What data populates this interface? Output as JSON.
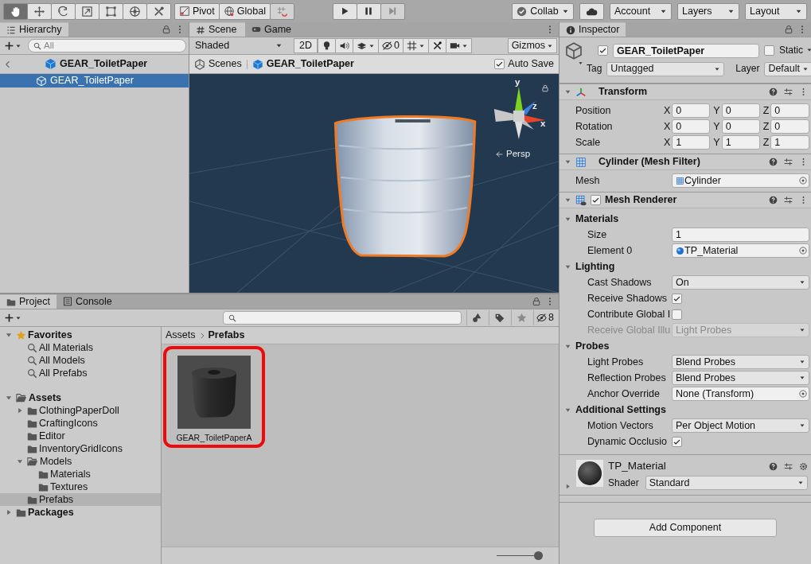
{
  "toolbar": {
    "tools": [
      {
        "kind": "hand",
        "selected": true
      },
      {
        "kind": "move",
        "selected": false
      },
      {
        "kind": "rotate",
        "selected": false
      },
      {
        "kind": "scale",
        "selected": false
      },
      {
        "kind": "rect",
        "selected": false
      },
      {
        "kind": "transform",
        "selected": false
      },
      {
        "kind": "custom",
        "selected": false
      }
    ],
    "pivot": "Pivot",
    "handle_space": "Global",
    "playback": [
      {
        "kind": "play",
        "disabled": false
      },
      {
        "kind": "pause",
        "disabled": false
      },
      {
        "kind": "step",
        "disabled": true
      }
    ],
    "collab": "Collab",
    "account": "Account",
    "layers": "Layers",
    "layout": "Layout"
  },
  "hierarchy": {
    "tabs": [
      {
        "kind": "hierarchy",
        "label": "Hierarchy",
        "selected": true
      }
    ],
    "search": {
      "placeholder": "All"
    },
    "scene": "GEAR_ToiletPaper",
    "items": [
      {
        "label": "GEAR_ToiletPaper",
        "selected": true
      }
    ]
  },
  "scene_view": {
    "tabs": [
      {
        "kind": "scene",
        "label": "Scene",
        "selected": true
      },
      {
        "kind": "game",
        "label": "Game",
        "selected": false
      }
    ],
    "shading": "Shaded",
    "toggle_2d": "2D",
    "hidden_count": "0",
    "gizmos": "Gizmos",
    "breadcrumbs": [
      {
        "kind": "scenes",
        "label": "Scenes"
      },
      {
        "kind": "prefab",
        "label": "GEAR_ToiletPaper"
      }
    ],
    "auto_save": {
      "label": "Auto Save",
      "checked": true
    },
    "gizmo_axes": [
      "y",
      "z",
      "x"
    ],
    "projection": "Persp"
  },
  "inspector": {
    "tabs": [
      {
        "kind": "inspector",
        "label": "Inspector",
        "selected": true
      }
    ],
    "object": {
      "active": true,
      "name": "GEAR_ToiletPaper",
      "static_label": "Static",
      "static": false,
      "tag_label": "Tag",
      "tag": "Untagged",
      "layer_label": "Layer",
      "layer": "Default"
    },
    "components": [
      {
        "kind": "transform",
        "title": "Transform",
        "expanded": true,
        "rows": [
          {
            "label": "Position",
            "values": [
              {
                "axis": "X",
                "value": "0"
              },
              {
                "axis": "Y",
                "value": "0"
              },
              {
                "axis": "Z",
                "value": "0"
              }
            ]
          },
          {
            "label": "Rotation",
            "values": [
              {
                "axis": "X",
                "value": "0"
              },
              {
                "axis": "Y",
                "value": "0"
              },
              {
                "axis": "Z",
                "value": "0"
              }
            ]
          },
          {
            "label": "Scale",
            "values": [
              {
                "axis": "X",
                "value": "1"
              },
              {
                "axis": "Y",
                "value": "1"
              },
              {
                "axis": "Z",
                "value": "1"
              }
            ]
          }
        ]
      },
      {
        "kind": "mesh_filter",
        "title": "Cylinder (Mesh Filter)",
        "expanded": true,
        "fields": [
          {
            "kind": "mesh",
            "label": "Mesh",
            "value": "Cylinder",
            "disabled": false
          }
        ]
      },
      {
        "kind": "mesh_renderer",
        "title": "Mesh Renderer",
        "expanded": true,
        "enabled": true,
        "sections": [
          {
            "title": "Materials",
            "expanded": true,
            "fields": [
              {
                "kind": "text",
                "label": "Size",
                "value": "1",
                "disabled": false
              },
              {
                "kind": "material",
                "label": "Element 0",
                "value": "TP_Material",
                "disabled": false
              }
            ]
          },
          {
            "title": "Lighting",
            "expanded": true,
            "fields": [
              {
                "kind": "dropdown",
                "label": "Cast Shadows",
                "value": "On",
                "disabled": false
              },
              {
                "kind": "checkbox",
                "label": "Receive Shadows",
                "checked": true,
                "disabled": false
              },
              {
                "kind": "checkbox",
                "label": "Contribute Global I",
                "checked": false,
                "disabled": false
              },
              {
                "kind": "dropdown",
                "label": "Receive Global Illu",
                "value": "Light Probes",
                "disabled": true
              }
            ]
          },
          {
            "title": "Probes",
            "expanded": true,
            "fields": [
              {
                "kind": "dropdown",
                "label": "Light Probes",
                "value": "Blend Probes",
                "disabled": false
              },
              {
                "kind": "dropdown",
                "label": "Reflection Probes",
                "value": "Blend Probes",
                "disabled": false
              },
              {
                "kind": "object",
                "label": "Anchor Override",
                "value": "None (Transform)",
                "disabled": false
              }
            ]
          },
          {
            "title": "Additional Settings",
            "expanded": true,
            "fields": [
              {
                "kind": "dropdown",
                "label": "Motion Vectors",
                "value": "Per Object Motion",
                "disabled": false
              },
              {
                "kind": "checkbox",
                "label": "Dynamic Occlusio",
                "checked": true,
                "disabled": false
              }
            ]
          }
        ]
      }
    ],
    "material": {
      "name": "TP_Material",
      "expanded": false,
      "shader_label": "Shader",
      "shader": "Standard"
    },
    "add_button": "Add Component"
  },
  "project": {
    "tabs": [
      {
        "kind": "project",
        "label": "Project",
        "selected": true
      },
      {
        "kind": "console",
        "label": "Console",
        "selected": false
      }
    ],
    "hidden_count": "8",
    "tree": [
      {
        "kind": "favorites",
        "label": "Favorites",
        "expanded": true,
        "selected": false,
        "children": [
          {
            "kind": "search",
            "label": "All Materials",
            "selected": false
          },
          {
            "kind": "search",
            "label": "All Models",
            "selected": false
          },
          {
            "kind": "search",
            "label": "All Prefabs",
            "selected": false
          }
        ]
      },
      {
        "kind": "folder",
        "label": "Assets",
        "expanded": true,
        "selected": false,
        "children": [
          {
            "kind": "folder",
            "label": "ClothingPaperDoll",
            "expanded": false,
            "selected": false
          },
          {
            "kind": "folder",
            "label": "CraftingIcons",
            "selected": false
          },
          {
            "kind": "folder",
            "label": "Editor",
            "selected": false
          },
          {
            "kind": "folder",
            "label": "InventoryGridIcons",
            "selected": false
          },
          {
            "kind": "folder",
            "label": "Models",
            "expanded": true,
            "selected": false,
            "children": [
              {
                "kind": "folder",
                "label": "Materials",
                "selected": false
              },
              {
                "kind": "folder",
                "label": "Textures",
                "selected": false
              }
            ]
          },
          {
            "kind": "folder",
            "label": "Prefabs",
            "selected": true
          }
        ]
      },
      {
        "kind": "folder",
        "label": "Packages",
        "expanded": false,
        "selected": false
      }
    ],
    "breadcrumbs": [
      "Assets",
      "Prefabs"
    ],
    "assets": [
      {
        "label": "GEAR_ToiletPaperA",
        "highlighted": true
      }
    ],
    "zoom": {
      "level": 1
    }
  }
}
